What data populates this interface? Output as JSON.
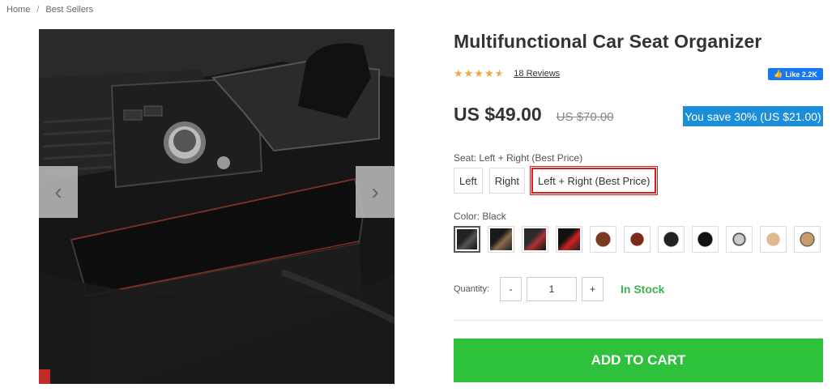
{
  "breadcrumb": {
    "home": "Home",
    "separator": "/",
    "current": "Best Sellers"
  },
  "gallery": {
    "prev_icon": "‹",
    "next_icon": "›"
  },
  "product": {
    "title": "Multifunctional Car Seat Organizer",
    "rating": 4.5,
    "reviews": "18 Reviews",
    "fb_like": "Like 2.2K",
    "price": "US $49.00",
    "old_price": "US $70.00",
    "save_text": "You save 30% (US $21.00)"
  },
  "seat": {
    "label": "Seat:",
    "selected": "Left + Right (Best Price)",
    "options": [
      "Left",
      "Right",
      "Left + Right (Best Price)"
    ]
  },
  "color": {
    "label": "Color:",
    "selected": "Black",
    "swatch_count": 11
  },
  "quantity": {
    "label": "Quantity:",
    "minus": "-",
    "value": "1",
    "plus": "+"
  },
  "stock": "In Stock",
  "cart": {
    "label": "ADD TO CART"
  },
  "colors": {
    "accent_green": "#2ec13b",
    "save_blue": "#1a8ed8",
    "highlight_red": "#e01a1a",
    "star": "#f0a93b"
  }
}
